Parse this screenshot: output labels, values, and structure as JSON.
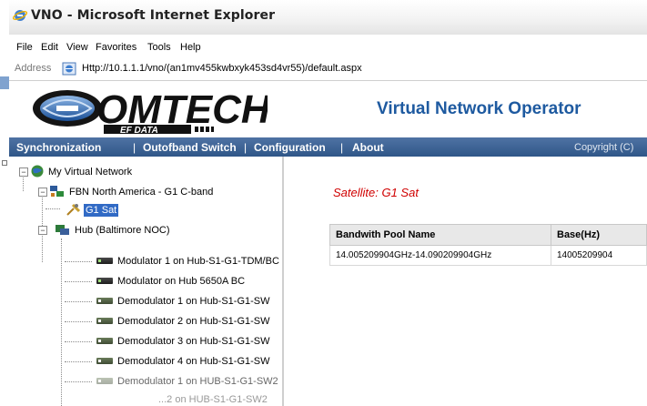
{
  "window": {
    "title": "VNO - Microsoft Internet Explorer"
  },
  "menu": [
    "File",
    "Edit",
    "View",
    "Favorites",
    "Tools",
    "Help"
  ],
  "address": {
    "label": "Address",
    "url": "Http://10.1.1.1/vno/(an1mv455kwbxyk453sd4vr55)/default.aspx"
  },
  "header": {
    "logo_text": "OMTECH",
    "logo_sub": "EF DATA",
    "product_title": "Virtual Network Operator"
  },
  "nav": {
    "items": [
      "Synchronization",
      "Outofband Switch",
      "Configuration",
      "About"
    ],
    "separator": "|",
    "copyright": "Copyright (C)"
  },
  "tree": {
    "root": "My Virtual Network",
    "network": "FBN North America - G1 C-band",
    "satellite": "G1 Sat",
    "hub": "Hub (Baltimore NOC)",
    "devices": [
      "Modulator 1 on Hub-S1-G1-TDM/BC",
      "Modulator on Hub 5650A BC",
      "Demodulator 1 on Hub-S1-G1-SW",
      "Demodulator 2 on Hub-S1-G1-SW",
      "Demodulator 3 on Hub-S1-G1-SW",
      "Demodulator 4 on Hub-S1-G1-SW",
      "Demodulator 1 on HUB-S1-G1-SW2",
      "...2 on HUB-S1-G1-SW2"
    ]
  },
  "main": {
    "satellite_heading": "Satellite: G1 Sat",
    "table": {
      "headers": [
        "Bandwith Pool Name",
        "Base(Hz)"
      ],
      "rows": [
        [
          "14.005209904GHz-14.090209904GHz",
          "14005209904"
        ]
      ]
    }
  },
  "colors": {
    "nav_bg": "#2f5688",
    "title_blue": "#1e5aa0",
    "satellite_red": "#d00000",
    "selected_bg": "#316ac5"
  }
}
